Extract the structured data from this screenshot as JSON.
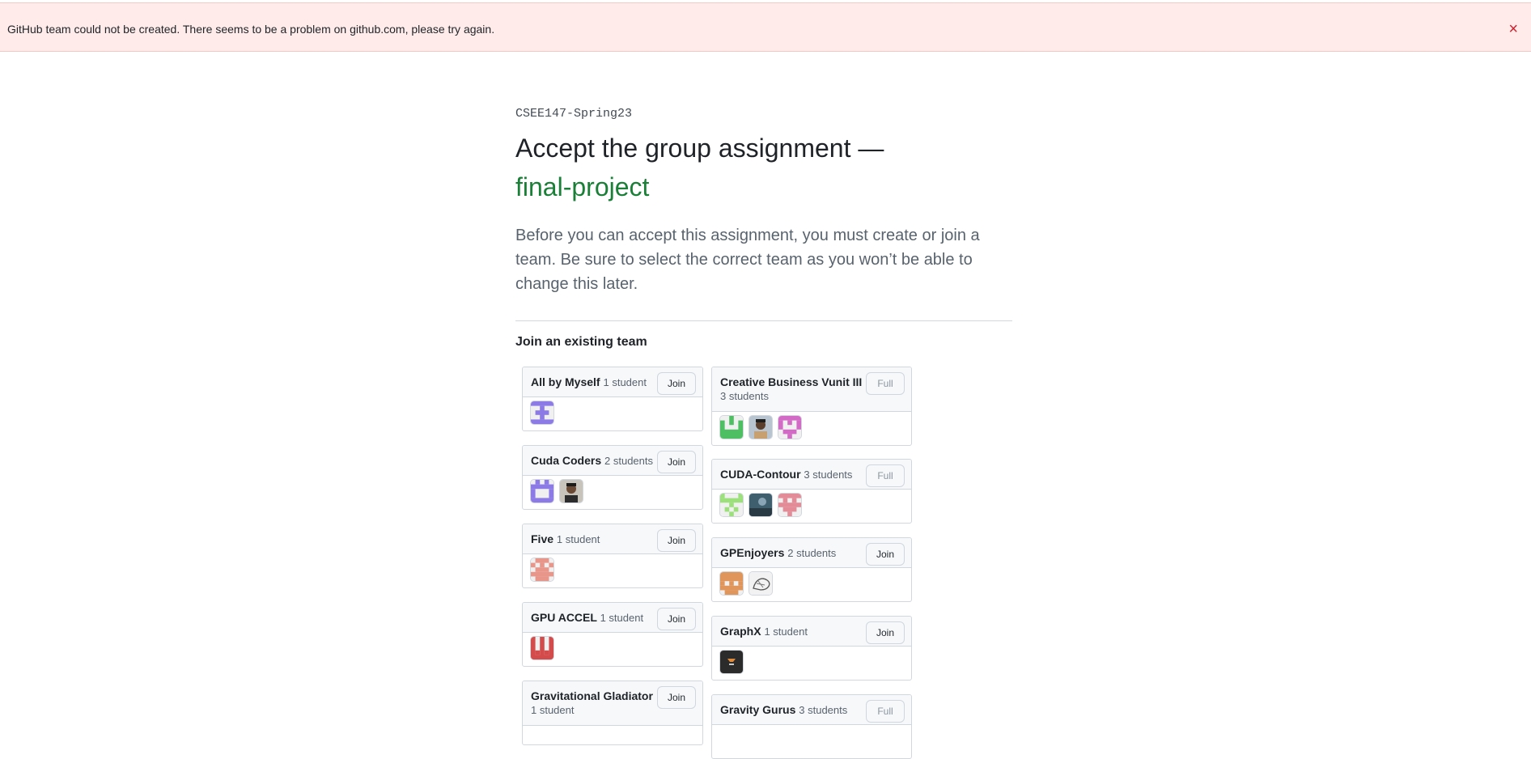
{
  "flash": {
    "message": "GitHub team could not be created. There seems to be a problem on github.com, please try again.",
    "close_label": "×"
  },
  "header": {
    "org": "CSEE147-Spring23",
    "title": "Accept the group assignment —",
    "assignment": "final-project"
  },
  "description": "Before you can accept this assignment, you must create or join a team. Be sure to select the correct team as you won’t be able to change this later.",
  "section_title": "Join an existing team",
  "teams_left": [
    {
      "name": "All by Myself",
      "count": "1 student",
      "button": "Join",
      "avatars": [
        "identicon-purple"
      ]
    },
    {
      "name": "Cuda Coders",
      "count": "2 students",
      "button": "Join",
      "avatars": [
        "identicon-purple",
        "photo-avatar"
      ]
    },
    {
      "name": "Five",
      "count": "1 student",
      "button": "Join",
      "avatars": [
        "identicon-salmon"
      ]
    },
    {
      "name": "GPU ACCEL",
      "count": "1 student",
      "button": "Join",
      "avatars": [
        "identicon-red"
      ]
    },
    {
      "name": "Gravitational Gladiator",
      "count": "1 student",
      "button": "Join",
      "avatars": []
    }
  ],
  "teams_right": [
    {
      "name": "Creative Business Vunit III",
      "count": "3 students",
      "button": "Full",
      "avatars": [
        "identicon-green",
        "photo-avatar",
        "identicon-pink"
      ]
    },
    {
      "name": "CUDA-Contour",
      "count": "3 students",
      "button": "Full",
      "avatars": [
        "identicon-lightgreen",
        "photo-avatar",
        "identicon-pink"
      ]
    },
    {
      "name": "GPEnjoyers",
      "count": "2 students",
      "button": "Join",
      "avatars": [
        "identicon-orange",
        "sketch-avatar"
      ]
    },
    {
      "name": "GraphX",
      "count": "1 student",
      "button": "Join",
      "avatars": [
        "dark-avatar"
      ]
    },
    {
      "name": "Gravity Gurus",
      "count": "3 students",
      "button": "Full",
      "avatars": []
    }
  ],
  "colors": {
    "flash_bg": "#ffebe9",
    "close": "#cf222e",
    "assignment_name": "#1a7f37"
  }
}
